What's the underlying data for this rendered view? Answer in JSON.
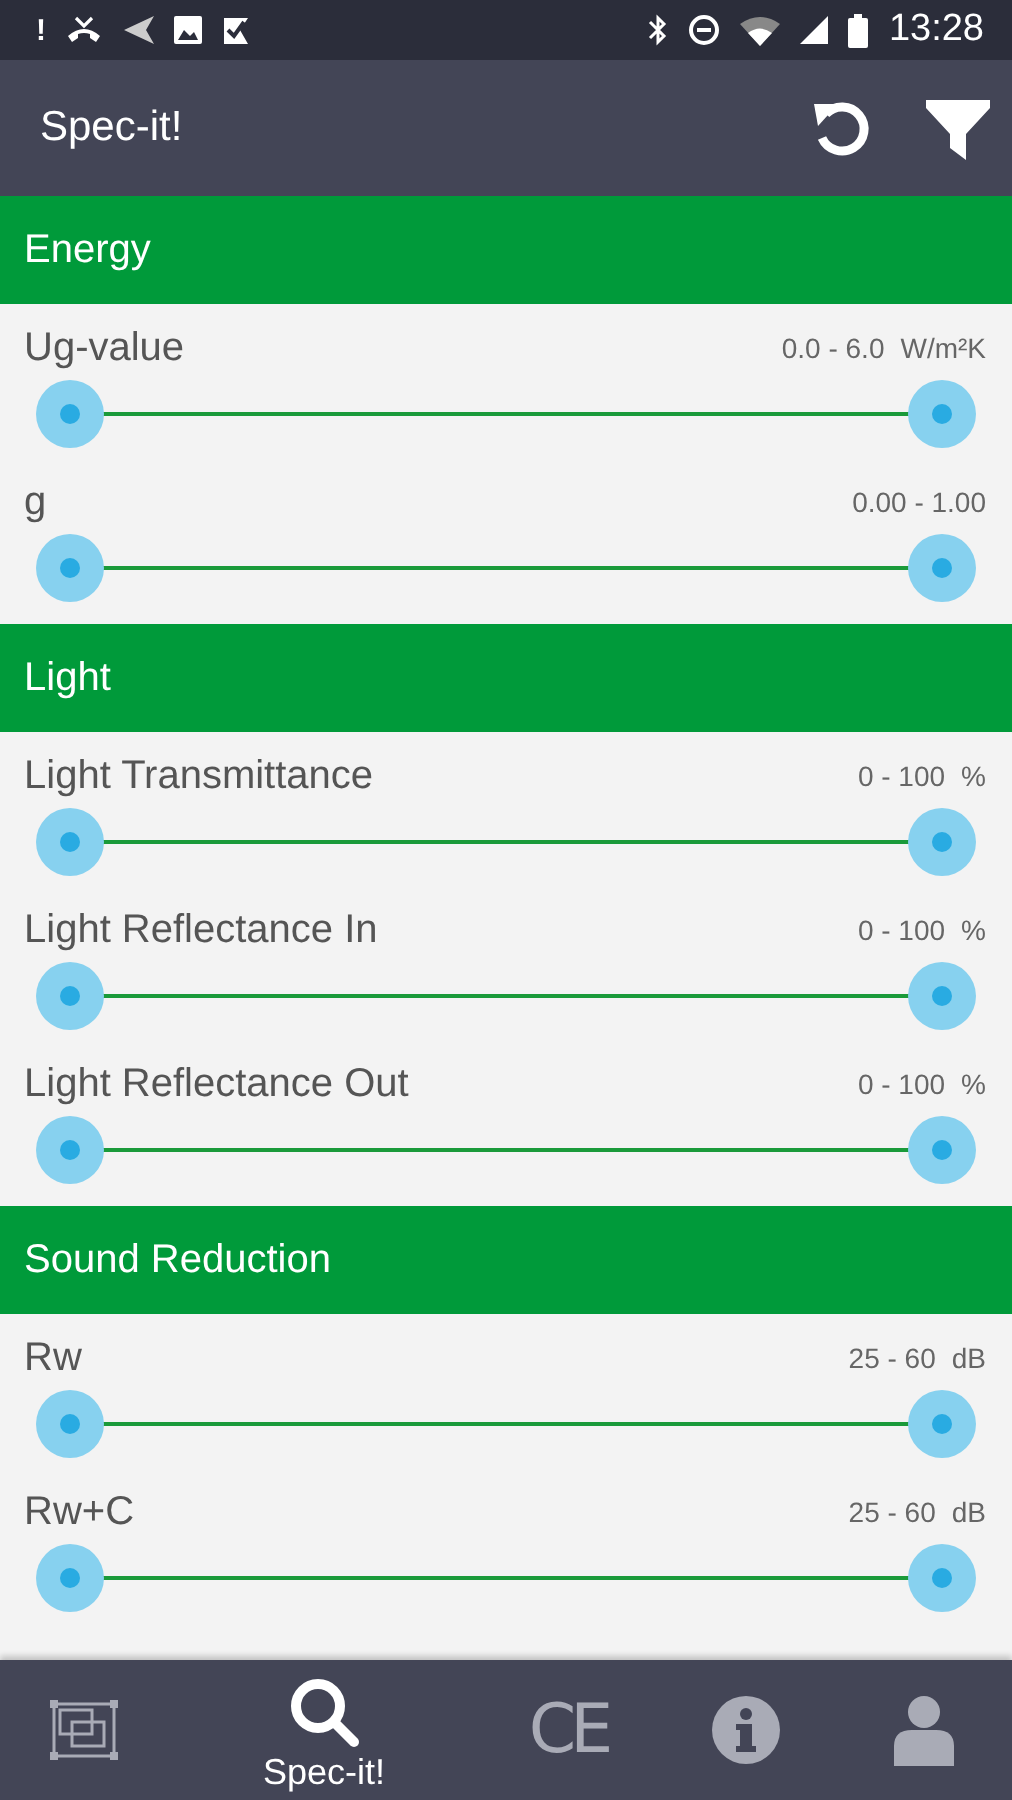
{
  "status_bar": {
    "alert": "!",
    "time": "13:28"
  },
  "app_bar": {
    "title": "Spec-it!"
  },
  "sections": [
    {
      "title": "Energy",
      "filters": [
        {
          "label": "Ug-value",
          "range": "0.0 - 6.0",
          "unit": "W/m²K"
        },
        {
          "label": "g",
          "range": "0.00 - 1.00"
        }
      ]
    },
    {
      "title": "Light",
      "filters": [
        {
          "label": "Light Transmittance",
          "range": "0 - 100",
          "unit": "%"
        },
        {
          "label": "Light Reflectance In",
          "range": "0 - 100",
          "unit": "%"
        },
        {
          "label": "Light Reflectance Out",
          "range": "0 - 100",
          "unit": "%"
        }
      ]
    },
    {
      "title": "Sound Reduction",
      "filters": [
        {
          "label": "Rw",
          "range": "25 - 60",
          "unit": "dB"
        },
        {
          "label": "Rw+C",
          "range": "25 - 60",
          "unit": "dB"
        }
      ]
    }
  ],
  "bottom_nav": [
    {
      "kind": "frames",
      "selected": false
    },
    {
      "kind": "search",
      "label": "Spec-it!",
      "selected": true
    },
    {
      "kind": "mark",
      "glyph": "CE",
      "selected": false
    },
    {
      "kind": "info",
      "selected": false
    },
    {
      "kind": "person",
      "selected": false
    }
  ]
}
